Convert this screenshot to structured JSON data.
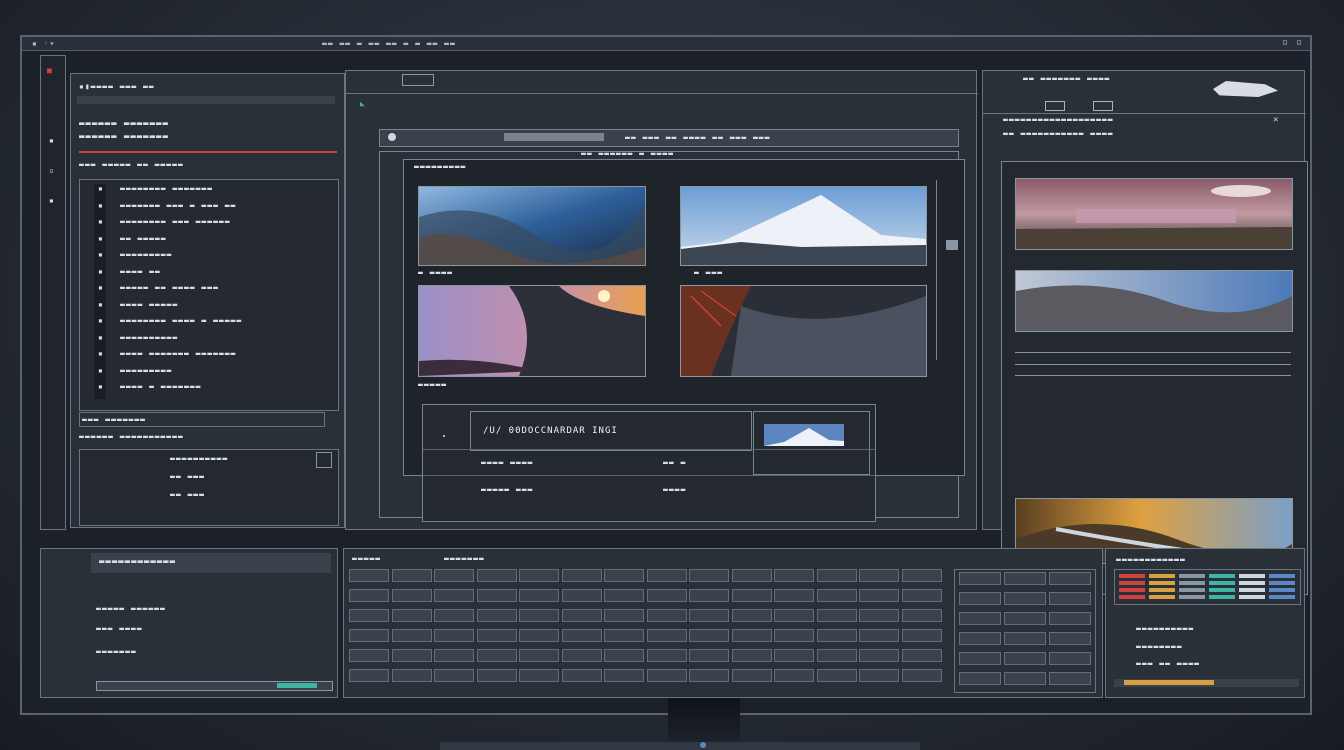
{
  "topbar": {
    "left_text": "▪ ◦▾",
    "center_text": "▬▬ ▬▬ ▬ ▬▬ ▬▬ ▬ ▬ ▬▬ ▬▬"
  },
  "left_panel": {
    "header_line1": "▪▮▬▬▬▬ ▬▬▬ ▬▬",
    "header_line2": "▬▬▬▬▬▬ ▬▬▬▬▬▬▬",
    "header_line3": "▬▬▬ ▬▬▬▬▬ ▬▬ ▬▬▬▬▬",
    "items": [
      "▬▬▬▬▬▬▬▬ ▬▬▬▬▬▬▬",
      "▬▬▬▬▬▬▬ ▬▬▬ ▬ ▬▬▬ ▬▬",
      "▬▬▬▬▬▬▬▬ ▬▬▬ ▬▬▬▬▬▬",
      "▬▬ ▬▬▬▬▬",
      "▬▬▬▬▬▬▬▬▬",
      "▬▬▬▬ ▬▬",
      "▬▬▬▬▬ ▬▬ ▬▬▬▬ ▬▬▬",
      "▬▬▬▬ ▬▬▬▬▬",
      "▬▬▬▬▬▬▬▬ ▬▬▬▬ ▬ ▬▬▬▬▬",
      "▬▬▬▬▬▬▬▬▬▬",
      "▬▬▬▬ ▬▬▬▬▬▬▬ ▬▬▬▬▬▬▬",
      "▬▬▬▬▬▬▬▬▬",
      "▬▬▬▬ ▬ ▬▬▬▬▬▬▬"
    ],
    "lower_header": "▬▬▬ ▬▬▬▬▬▬▬",
    "lower_row1": "▬▬▬▬▬▬ ▬▬▬▬▬▬▬▬▬▬▬",
    "lower_row2": "▬▬▬▬▬▬▬▬▬▬",
    "lower_row3": "▬▬ ▬▬▬",
    "lower_row4": "▬▬ ▬▬▬"
  },
  "center_panel": {
    "toolbar_text": "▬▬ ▬▬▬ ▬▬ ▬▬▬▬ ▬▬ ▬▬▬ ▬▬▬",
    "subtitle": "▬▬ ▬▬▬▬▬▬ ▬ ▬▬▬▬",
    "gallery_header": "▬▬▬▬▬▬▬▬▬",
    "thumb_caption_1": "▬ ▬▬▬▬",
    "thumb_caption_2": "▬ ▬▬▬",
    "thumb_caption_3": "▬▬▬▬▬",
    "thumb_caption_4": "",
    "info_title": "/U/ 00DOCCNARDAR INGI",
    "info_row1a": "▬▬▬▬ ▬▬▬▬",
    "info_row1b": "▬▬ ▬",
    "info_row2a": "▬▬▬▬▬ ▬▬▬",
    "info_row2b": "▬▬▬▬"
  },
  "right_panel": {
    "header_text": "▬▬ ▬▬▬▬▬▬▬ ▬▬▬▬",
    "tabs": [
      "▬▬",
      "▬▬"
    ],
    "sub_header": "▬▬▬▬▬▬▬▬▬▬▬▬▬▬▬▬▬▬▬",
    "list_text": "▬▬ ▬▬▬▬▬▬▬▬▬▬▬ ▬▬▬▬",
    "footer_text": "▬▬▬▬▬ ▬▬▬▬▬▬▬▬"
  },
  "bottom_left": {
    "title": "▬▬▬▬▬▬▬▬▬▬▬▬",
    "row1": "▬▬▬▬▬ ▬▬▬▬▬▬",
    "row2": "▬▬▬ ▬▬▬▬",
    "row3": "▬▬▬▬▬▬▬"
  },
  "keyboard_panel": {
    "tabs": [
      "▬▬▬▬▬",
      "▬▬▬▬▬▬▬"
    ]
  },
  "bottom_right": {
    "header": "▬▬▬▬▬▬▬▬▬▬▬▬",
    "line1": "▬▬▬▬▬▬▬▬▬▬",
    "line2": "▬▬▬▬▬▬▬▬",
    "line3": "▬▬▬ ▬▬ ▬▬▬▬"
  },
  "colors": {
    "accent_teal": "#3fb4a6",
    "accent_orange": "#d9a040",
    "accent_red": "#d04040"
  }
}
